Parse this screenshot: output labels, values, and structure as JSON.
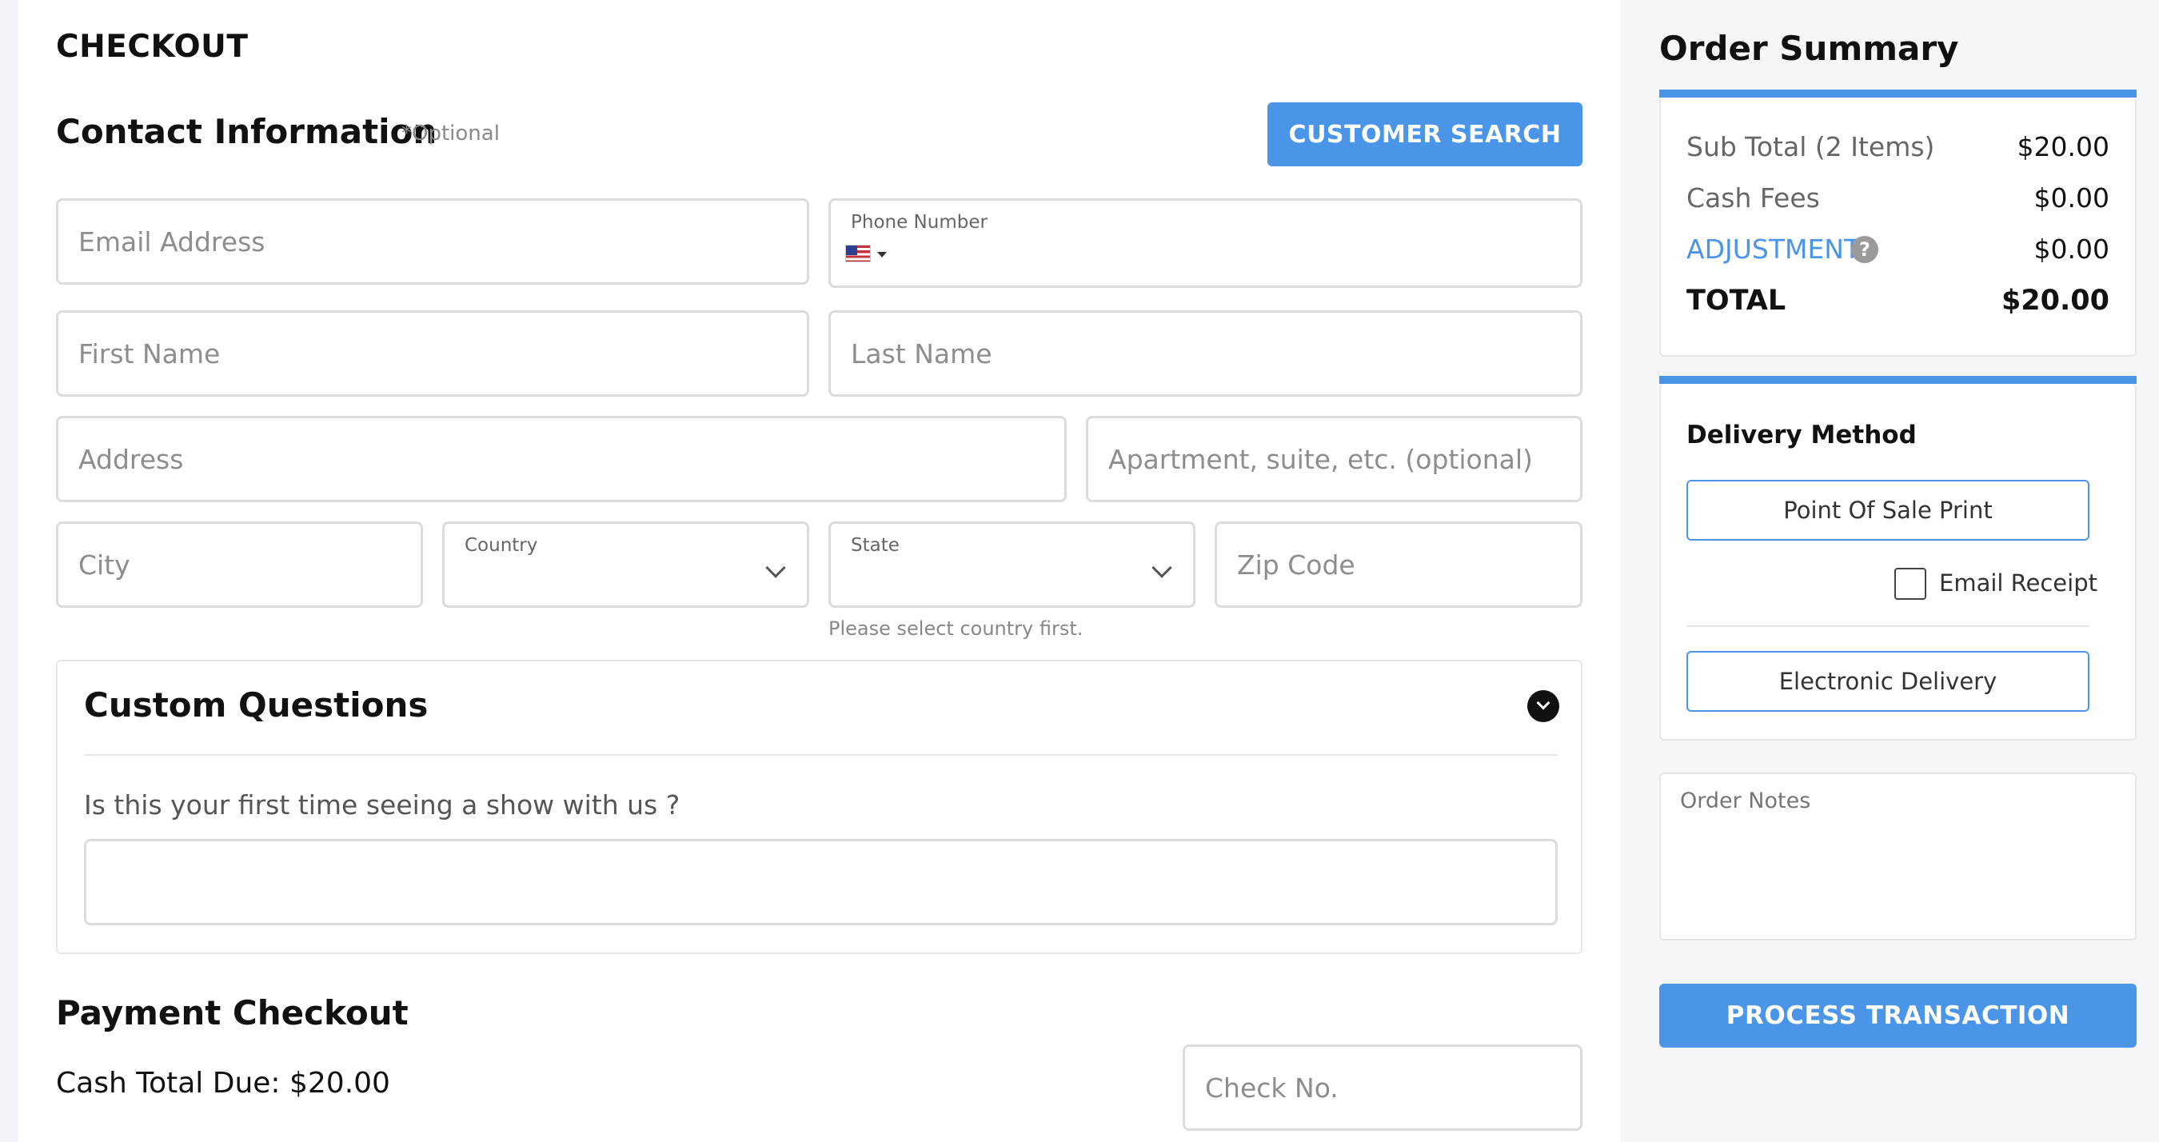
{
  "checkout": {
    "title": "CHECKOUT",
    "contact_title": "Contact Information",
    "optional_label": "*Optional",
    "customer_search_button": "CUSTOMER SEARCH",
    "fields": {
      "email_placeholder": "Email Address",
      "phone_label": "Phone Number",
      "first_name_placeholder": "First Name",
      "last_name_placeholder": "Last Name",
      "address_placeholder": "Address",
      "apartment_placeholder": "Apartment, suite, etc. (optional)",
      "city_placeholder": "City",
      "country_label": "Country",
      "state_label": "State",
      "zip_placeholder": "Zip Code",
      "state_hint": "Please select country first."
    },
    "custom_questions": {
      "title": "Custom Questions",
      "question": "Is this your first time seeing a show with us ?"
    },
    "payment": {
      "title": "Payment Checkout",
      "cash_total": "Cash Total Due: $20.00",
      "check_placeholder": "Check No."
    }
  },
  "summary": {
    "title": "Order Summary",
    "rows": [
      {
        "label": "Sub Total (2 Items)",
        "value": "$20.00"
      },
      {
        "label": "Cash Fees",
        "value": "$0.00"
      },
      {
        "label": "ADJUSTMENTS",
        "value": "$0.00"
      },
      {
        "label": "TOTAL",
        "value": "$20.00"
      }
    ],
    "help_icon": "question-circle-icon",
    "delivery": {
      "title": "Delivery Method",
      "pos_print_button": "Point Of Sale Print",
      "email_receipt_label": "Email Receipt",
      "electronic_button": "Electronic Delivery"
    },
    "order_notes_placeholder": "Order Notes",
    "process_button": "PROCESS TRANSACTION"
  },
  "colors": {
    "accent": "#4a95e8",
    "background": "#f6f6f8"
  }
}
